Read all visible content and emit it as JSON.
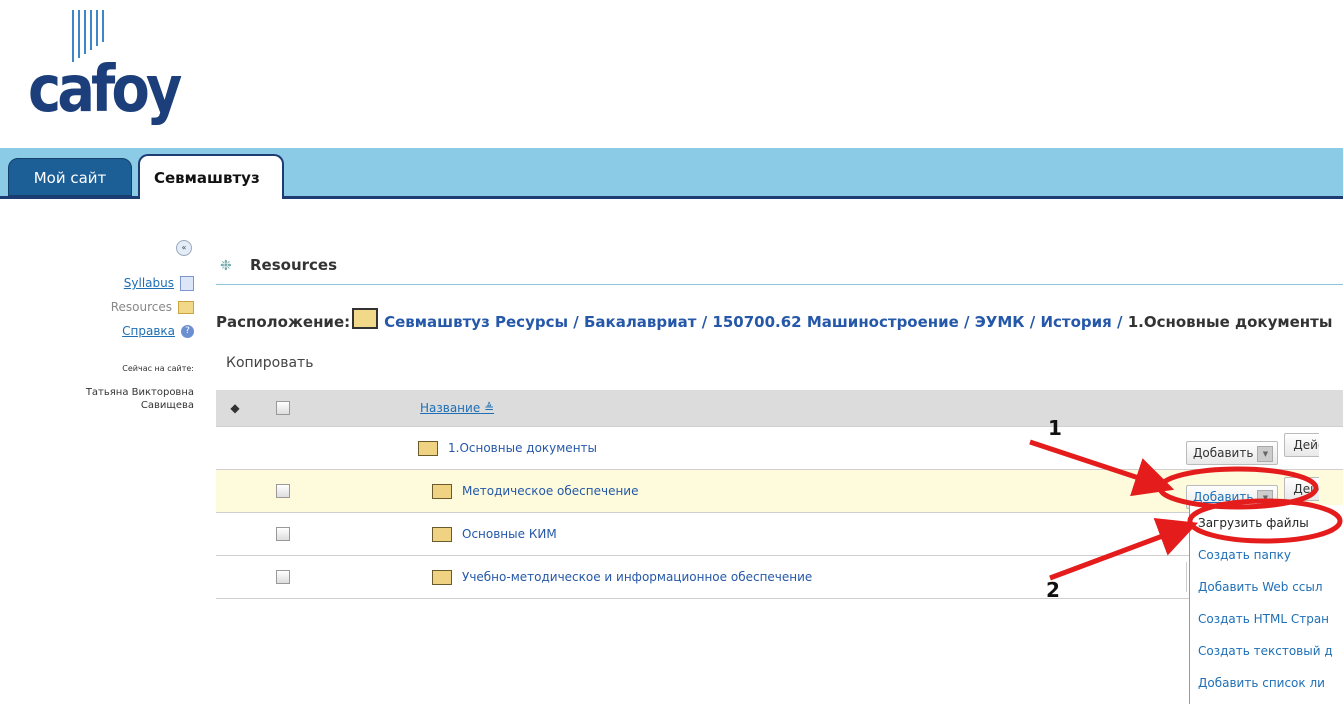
{
  "logo": {
    "text": "cafoy"
  },
  "tabs": [
    {
      "label": "Мой сайт",
      "active": false
    },
    {
      "label": "Севмашвтуз",
      "active": true
    }
  ],
  "sidebar": {
    "items": [
      {
        "label": "Syllabus",
        "icon": "document-icon",
        "link": true
      },
      {
        "label": "Resources",
        "icon": "folder-icon",
        "link": false
      },
      {
        "label": "Справка",
        "icon": "help-icon",
        "link": true
      }
    ],
    "online_label": "Сейчас на сайте:",
    "online_user_line1": "Татьяна Викторовна",
    "online_user_line2": "Савищева"
  },
  "main": {
    "title": "Resources",
    "breadcrumb_prefix": "Расположение:",
    "breadcrumb_path": "Севмашвтуз Ресурсы / Бакалавриат / 150700.62 Машиностроение / ЭУМК / История /",
    "breadcrumb_current": "1.Основные документы",
    "copy_label": "Копировать",
    "column_name": "Название",
    "add_label": "Добавить",
    "actions_label": "Действия",
    "rows": [
      {
        "name": "1.Основные документы",
        "checkbox": false
      },
      {
        "name": "Методическое обеспечение",
        "checkbox": true,
        "highlight": true
      },
      {
        "name": "Основные КИМ",
        "checkbox": true
      },
      {
        "name": "Учебно-методическое и информационное обеспечение",
        "checkbox": true
      }
    ]
  },
  "menu": {
    "items": [
      "Загрузить файлы",
      "Создать папку",
      "Добавить Web ссыл",
      "Создать HTML Стран",
      "Создать текстовый д",
      "Добавить список ли"
    ]
  },
  "annotations": {
    "step1": "1",
    "step2": "2",
    "color": "#e41c1c"
  },
  "colors": {
    "tabbar": "#8ccbe6",
    "tab_inactive": "#1c5e96",
    "link": "#1e6fb5",
    "highlight_row": "#fdfbdc"
  }
}
